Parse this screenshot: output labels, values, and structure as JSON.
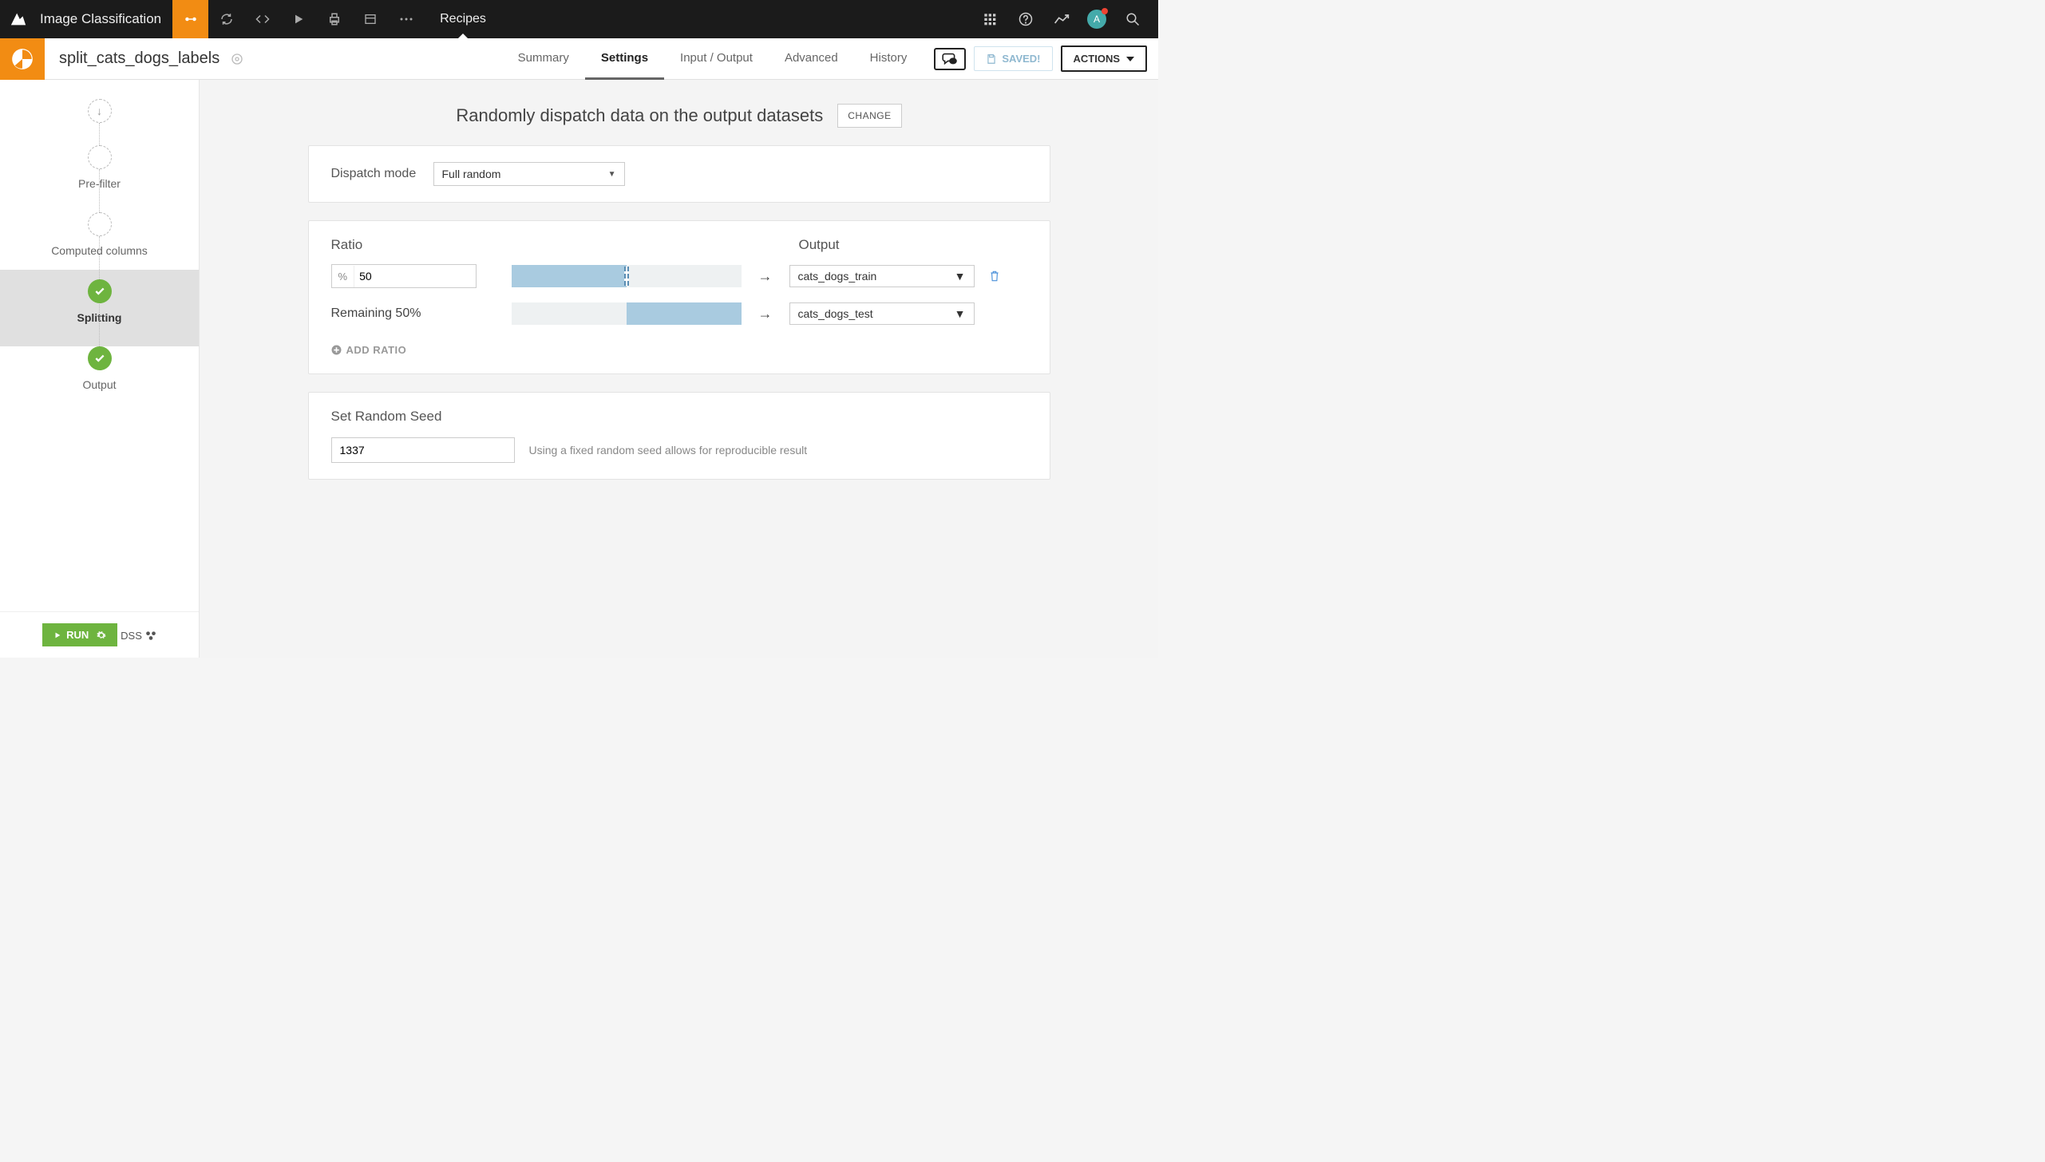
{
  "topbar": {
    "project": "Image Classification",
    "breadcrumb": "Recipes",
    "avatar_letter": "A"
  },
  "subheader": {
    "recipe_name": "split_cats_dogs_labels",
    "tabs": {
      "summary": "Summary",
      "settings": "Settings",
      "io": "Input / Output",
      "advanced": "Advanced",
      "history": "History"
    },
    "saved": "SAVED!",
    "actions": "ACTIONS"
  },
  "sidebar": {
    "steps": {
      "prefilter": "Pre-filter",
      "computed": "Computed columns",
      "splitting": "Splitting",
      "output": "Output"
    },
    "run": "RUN",
    "dss": "DSS"
  },
  "content": {
    "title": "Randomly dispatch data on the output datasets",
    "change": "CHANGE",
    "dispatch_label": "Dispatch mode",
    "dispatch_value": "Full random",
    "ratio_header": "Ratio",
    "output_header": "Output",
    "ratio_value": "50",
    "remaining_text": "Remaining 50%",
    "output1": "cats_dogs_train",
    "output2": "cats_dogs_test",
    "add_ratio": "ADD RATIO",
    "seed_title": "Set Random Seed",
    "seed_value": "1337",
    "seed_hint": "Using a fixed random seed allows for reproducible result"
  }
}
